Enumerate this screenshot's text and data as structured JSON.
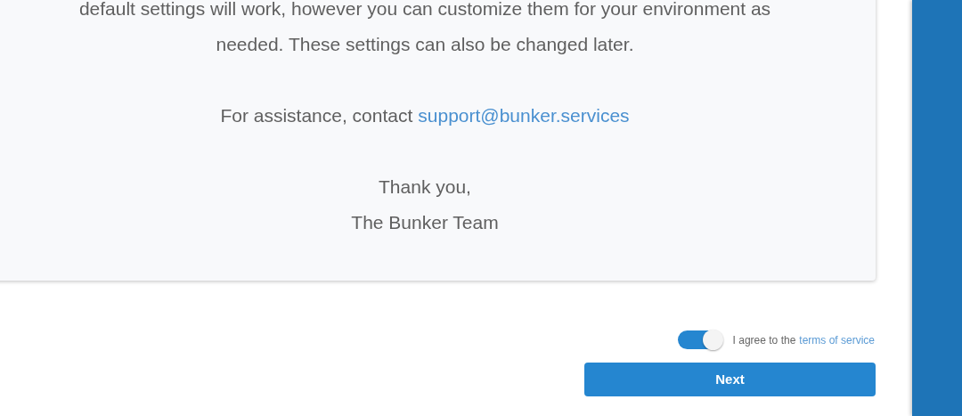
{
  "message": {
    "intro_lines": [
      "default settings will work, however you can customize them for your environment as",
      "needed. These settings can also be changed later."
    ],
    "assistance_text": "For assistance, contact",
    "support_email": "support@bunker.services",
    "signoff_lines": [
      "Thank you,",
      "The Bunker Team"
    ]
  },
  "agreement": {
    "on": true,
    "label": "I agree to the",
    "link": "terms of service"
  },
  "next_button": "Next"
}
